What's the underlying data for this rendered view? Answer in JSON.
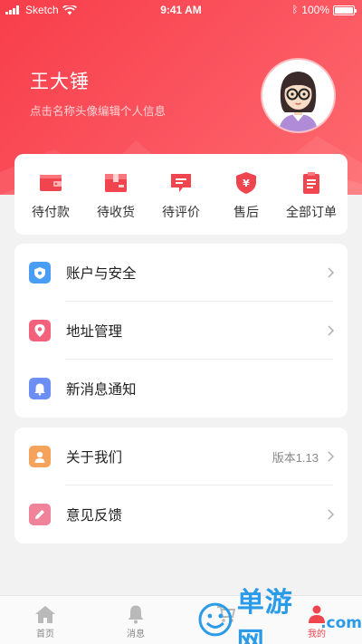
{
  "status_bar": {
    "carrier": "Sketch",
    "time": "9:41 AM",
    "battery": "100%"
  },
  "profile": {
    "name": "王大锤",
    "hint": "点击名称头像编辑个人信息"
  },
  "orders": [
    {
      "label": "待付款",
      "icon": "wallet-icon"
    },
    {
      "label": "待收货",
      "icon": "package-icon"
    },
    {
      "label": "待评价",
      "icon": "comment-icon"
    },
    {
      "label": "售后",
      "icon": "shield-yen-icon"
    },
    {
      "label": "全部订单",
      "icon": "clipboard-icon"
    }
  ],
  "menu_group_1": [
    {
      "label": "账户与安全",
      "icon": "shield-icon",
      "color": "#4a9df5",
      "has_chevron": true
    },
    {
      "label": "地址管理",
      "icon": "location-pin-icon",
      "color": "#f2627a",
      "has_chevron": true
    },
    {
      "label": "新消息通知",
      "icon": "bell-icon",
      "color": "#6b8ff5",
      "has_chevron": false
    }
  ],
  "menu_group_2": [
    {
      "label": "关于我们",
      "icon": "person-icon",
      "color": "#f5a25b",
      "value": "版本1.13",
      "has_chevron": true
    },
    {
      "label": "意见反馈",
      "icon": "pencil-icon",
      "color": "#f0829a",
      "has_chevron": true
    }
  ],
  "tabbar": [
    {
      "label": "首页",
      "icon": "home-icon"
    },
    {
      "label": "消息",
      "icon": "bell-icon"
    },
    {
      "label": "",
      "icon": "cart-icon"
    },
    {
      "label": "我的",
      "icon": "profile-icon",
      "active": true
    }
  ],
  "watermark": {
    "text": "单游网",
    "domain": ".com"
  },
  "colors": {
    "primary_red": "#f73e4a",
    "page_bg": "#f2f2f2"
  }
}
